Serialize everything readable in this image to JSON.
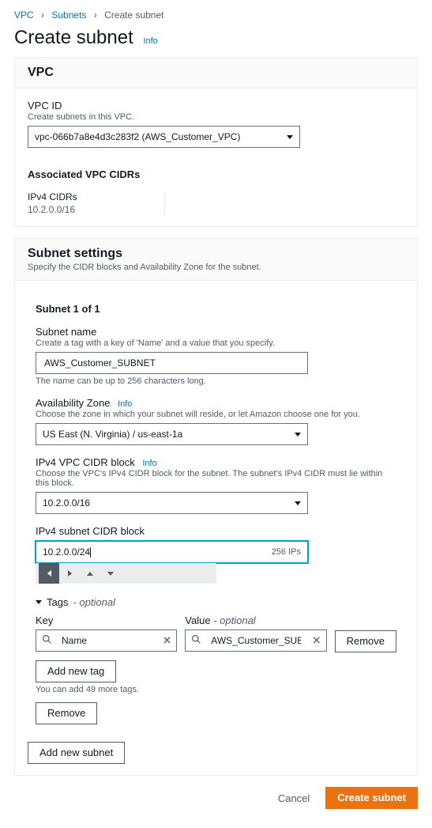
{
  "breadcrumbs": {
    "vpc": "VPC",
    "subnets": "Subnets",
    "current": "Create subnet"
  },
  "page_title": "Create subnet",
  "info_label": "Info",
  "vpc_card": {
    "heading": "VPC",
    "id_label": "VPC ID",
    "id_help": "Create subnets in this VPC.",
    "id_value": "vpc-066b7a8e4d3c283f2 (AWS_Customer_VPC)",
    "assoc_heading": "Associated VPC CIDRs",
    "ipv4_label": "IPv4 CIDRs",
    "ipv4_value": "10.2.0.0/16"
  },
  "subnet_card": {
    "heading": "Subnet settings",
    "sub": "Specify the CIDR blocks and Availability Zone for the subnet.",
    "counter": "Subnet 1 of 1",
    "name_label": "Subnet name",
    "name_help": "Create a tag with a key of 'Name' and a value that you specify.",
    "name_value": "AWS_Customer_SUBNET",
    "name_hint": "The name can be up to 256 characters long.",
    "az_label": "Availability Zone",
    "az_help": "Choose the zone in which your subnet will reside, or let Amazon choose one for you.",
    "az_value": "US East (N. Virginia) / us-east-1a",
    "cidrblock_label": "IPv4 VPC CIDR block",
    "cidrblock_help": "Choose the VPC's IPv4 CIDR block for the subnet. The subnet's IPv4 CIDR must lie within this block.",
    "cidrblock_value": "10.2.0.0/16",
    "subnetcidr_label": "IPv4 subnet CIDR block",
    "subnetcidr_value": "10.2.0.0/24",
    "subnetcidr_hint": "256 IPs",
    "tags_label": "Tags",
    "tags_optional": "- optional",
    "key_header": "Key",
    "value_header": "Value",
    "value_optional": "- optional",
    "tag_key": "Name",
    "tag_value": "AWS_Customer_SUBNET",
    "remove_tag": "Remove",
    "add_tag": "Add new tag",
    "tag_limit": "You can add 49 more tags.",
    "remove_subnet": "Remove",
    "add_subnet": "Add new subnet"
  },
  "footer": {
    "cancel": "Cancel",
    "submit": "Create subnet"
  }
}
